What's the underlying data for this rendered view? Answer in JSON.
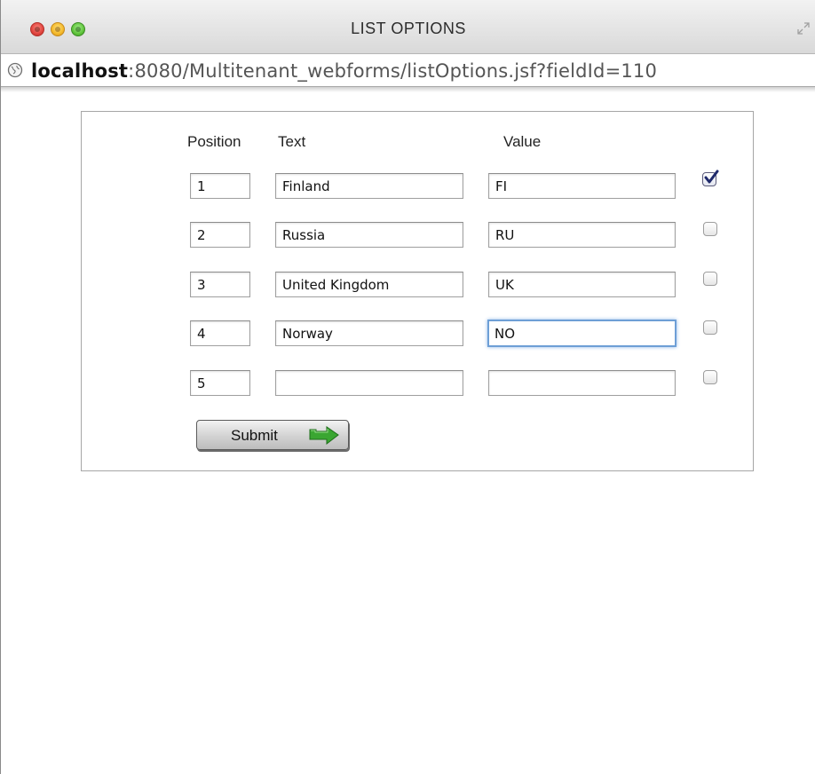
{
  "window": {
    "title": "LIST OPTIONS"
  },
  "address_bar": {
    "host": "localhost",
    "path": ":8080/Multitenant_webforms/listOptions.jsf?fieldId=110"
  },
  "form": {
    "headers": {
      "position": "Position",
      "text": "Text",
      "value": "Value"
    },
    "rows": [
      {
        "position": "1",
        "text": "Finland",
        "value": "FI",
        "checked": true
      },
      {
        "position": "2",
        "text": "Russia",
        "value": "RU",
        "checked": false
      },
      {
        "position": "3",
        "text": "United Kingdom",
        "value": "UK",
        "checked": false
      },
      {
        "position": "4",
        "text": "Norway",
        "value": "NO",
        "checked": false
      },
      {
        "position": "5",
        "text": "",
        "value": "",
        "checked": false
      }
    ],
    "submit_label": "Submit"
  },
  "colors": {
    "focus_ring": "#6e9fd6",
    "arrow_green": "#3aa632",
    "checkmark": "#1f2a6b"
  }
}
